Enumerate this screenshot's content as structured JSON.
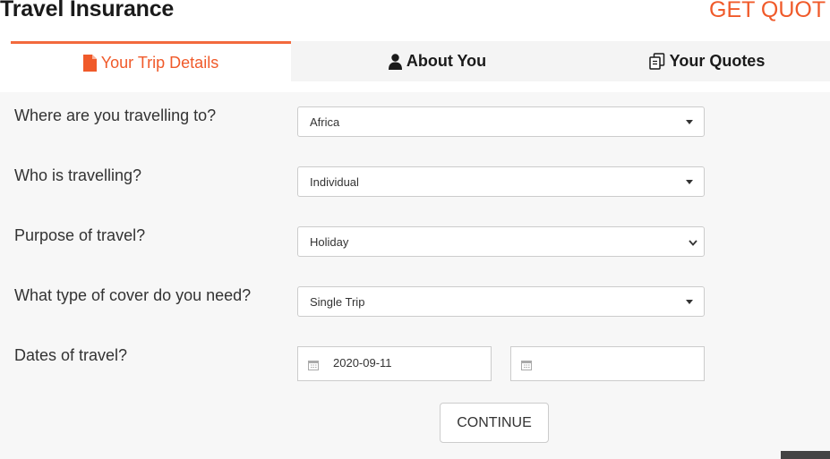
{
  "header": {
    "title": "Travel Insurance",
    "get_quote_label": "GET QUOT"
  },
  "tabs": [
    {
      "label": "Your Trip Details",
      "icon": "file-icon",
      "active": true
    },
    {
      "label": "About You",
      "icon": "user-icon",
      "active": false
    },
    {
      "label": "Your Quotes",
      "icon": "copy-icon",
      "active": false
    }
  ],
  "form": {
    "destination": {
      "label": "Where are you travelling to?",
      "value": "Africa"
    },
    "travellers": {
      "label": "Who is travelling?",
      "value": "Individual"
    },
    "purpose": {
      "label": "Purpose of travel?",
      "value": "Holiday"
    },
    "cover": {
      "label": "What type of cover do you need?",
      "value": "Single Trip"
    },
    "dates": {
      "label": "Dates of travel?",
      "start": "2020-09-11",
      "end": ""
    },
    "continue_label": "CONTINUE"
  },
  "colors": {
    "accent": "#f05a2a",
    "tab_bar": "#f4f4f4",
    "panel": "#f7f7f7",
    "text": "#333333"
  }
}
